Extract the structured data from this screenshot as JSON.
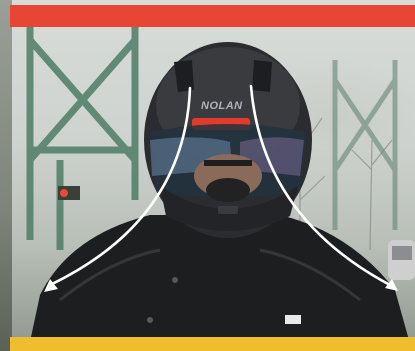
{
  "image": {
    "scene": "rider",
    "helmet_brand": "NOLAN"
  },
  "colors": {
    "top_band": "#e64632",
    "bottom_band": "#f0bd2e",
    "arrow": "#ffffff"
  }
}
